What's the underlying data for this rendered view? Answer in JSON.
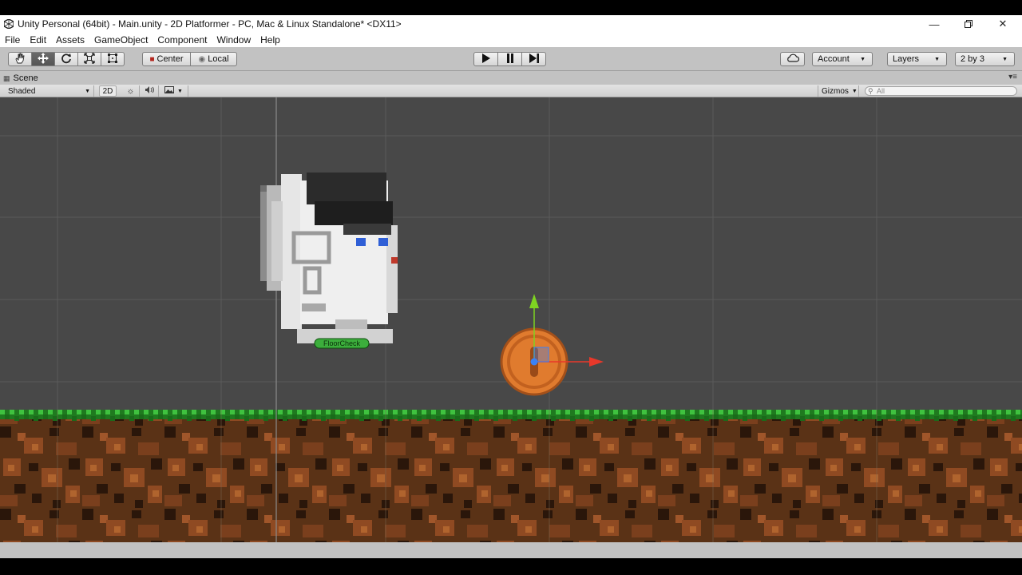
{
  "window": {
    "title": "Unity Personal (64bit) - Main.unity - 2D Platformer - PC, Mac & Linux Standalone* <DX11>",
    "minimize_icon": "minimize-icon",
    "restore_icon": "restore-icon",
    "close_icon": "close-icon"
  },
  "menu": {
    "items": [
      "File",
      "Edit",
      "Assets",
      "GameObject",
      "Component",
      "Window",
      "Help"
    ]
  },
  "toolbar": {
    "tools": [
      "hand-icon",
      "move-icon",
      "rotate-icon",
      "scale-icon",
      "rect-icon"
    ],
    "active_tool": "move-icon",
    "pivot_label": "Center",
    "space_label": "Local",
    "play_icon": "play-icon",
    "pause_icon": "pause-icon",
    "step_icon": "step-icon",
    "cloud_icon": "cloud-icon",
    "account_label": "Account",
    "layers_label": "Layers",
    "layout_label": "2 by 3"
  },
  "scene": {
    "tab_label": "Scene",
    "shading_mode": "Shaded",
    "mode_2d_label": "2D",
    "gizmos_label": "Gizmos",
    "search_placeholder": "All",
    "floor_check_label": "FloorCheck",
    "colors": {
      "background": "#484848",
      "grass": "#2fa72f",
      "dirt": "#5a3216",
      "coin": "#e07b2e",
      "gizmo_y": "#7ed321",
      "gizmo_x": "#e8382a",
      "gizmo_center": "#3b82f6"
    }
  }
}
